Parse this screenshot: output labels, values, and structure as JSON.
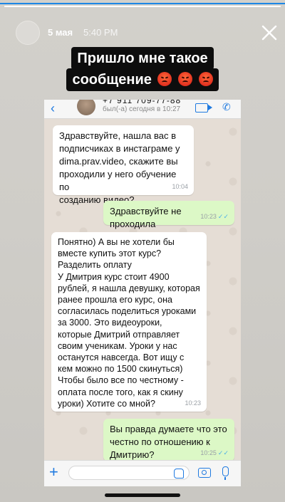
{
  "story": {
    "progress": 1.0,
    "date": "5 мая",
    "time": "5:40 PM",
    "caption_line1": "Пришло мне такое",
    "caption_line2": "сообщение",
    "caption_emoji": [
      "angry-face-emoji",
      "angry-face-emoji",
      "angry-face-emoji"
    ]
  },
  "chat": {
    "contact_number": "+7 911 709-77-88",
    "contact_status": "был(-а) сегодня в 10:27",
    "messages": [
      {
        "direction": "in",
        "text": "Здравствуйте, нашла вас в\nподписчиках в инстаграме у\ndima.prav.video, скажите вы\nпроходили у него обучение по\nсозданию видео?",
        "time": "10:04"
      },
      {
        "direction": "out",
        "text": "Здравствуйте не проходила",
        "time": "10:23"
      },
      {
        "direction": "in",
        "text": "Понятно) А вы не хотели бы\nвместе купить этот курс?\nРазделить оплату\nУ Дмитрия курс стоит 4900\nрублей, я нашла девушку, которая\nранее прошла его курс, она\nсогласилась поделиться уроками\nза 3000. Это видеоуроки,\nкоторые Дмитрий отправляет\nсвоим ученикам. Уроки у нас\nостанутся навсегда. Вот ищу с\nкем можно по 1500 скинуться)\nЧтобы было все по честному -\nоплата после того, как я скину\nуроки) Хотите со мной?",
        "time": "10:23"
      },
      {
        "direction": "out",
        "text": "Вы правда думаете что это\nчестно по отношению к\nДмитрию?",
        "time": "10:25"
      }
    ],
    "composer_placeholder": ""
  },
  "colors": {
    "accent_blue": "#1f7ae0",
    "bubble_in": "#ffffff",
    "bubble_out": "#dcf8c6",
    "read_ticks": "#4fb0e6",
    "caption_bg": "#0d0d0d"
  }
}
